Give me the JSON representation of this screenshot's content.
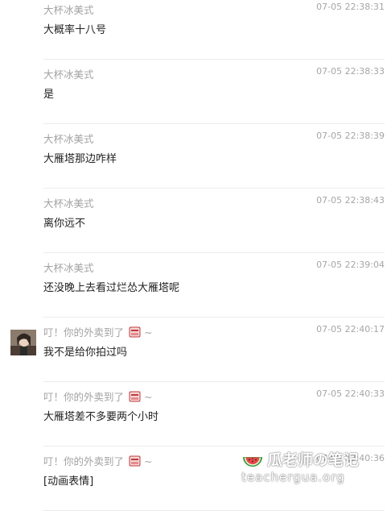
{
  "messages": [
    {
      "sender": "大杯冰美式",
      "has_emoji": false,
      "time": "07-05 22:38:31",
      "text": "大概率十八号",
      "has_avatar": false
    },
    {
      "sender": "大杯冰美式",
      "has_emoji": false,
      "time": "07-05 22:38:33",
      "text": "是",
      "has_avatar": false
    },
    {
      "sender": "大杯冰美式",
      "has_emoji": false,
      "time": "07-05 22:38:39",
      "text": "大雁塔那边咋样",
      "has_avatar": false
    },
    {
      "sender": "大杯冰美式",
      "has_emoji": false,
      "time": "07-05 22:38:43",
      "text": "离你远不",
      "has_avatar": false
    },
    {
      "sender": "大杯冰美式",
      "has_emoji": false,
      "time": "07-05 22:39:04",
      "text": "还没晚上去看过烂怂大雁塔呢",
      "has_avatar": false
    },
    {
      "sender": "叮！你的外卖到了",
      "has_emoji": true,
      "suffix": "~",
      "time": "07-05 22:40:17",
      "text": "我不是给你拍过吗",
      "has_avatar": true
    },
    {
      "sender": "叮！你的外卖到了",
      "has_emoji": true,
      "suffix": "~",
      "time": "07-05 22:40:33",
      "text": "大雁塔差不多要两个小时",
      "has_avatar": false
    },
    {
      "sender": "叮！你的外卖到了",
      "has_emoji": true,
      "suffix": "~",
      "time": "07-05 22:40:36",
      "text": "[动画表情]",
      "has_avatar": false
    }
  ],
  "watermark": {
    "title": "瓜老师の笔记",
    "url": "teachergua.org"
  },
  "icons": {
    "sender_emoji": "takeout-bag-icon",
    "watermark_logo": "watermelon-icon"
  },
  "colors": {
    "sender": "#a3a3a3",
    "time": "#a6a6a6",
    "text": "#222222",
    "divider": "#ececec"
  }
}
